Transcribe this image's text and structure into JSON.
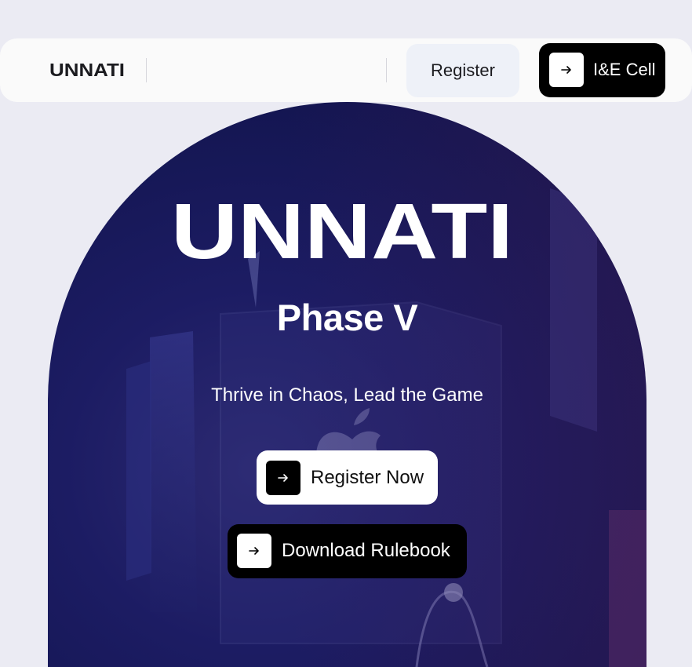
{
  "navbar": {
    "logo_text": "UNNATI",
    "register_label": "Register",
    "ie_cell_label": "I&E Cell"
  },
  "hero": {
    "logo_text": "UNNATI",
    "phase": "Phase V",
    "tagline": "Thrive in Chaos, Lead the Game",
    "register_now_label": "Register Now",
    "rulebook_label": "Download Rulebook"
  },
  "icons": {
    "arrow": "arrow-right-icon",
    "background": "apple-icon"
  },
  "colors": {
    "page_bg": "#ebebf3",
    "nav_bg": "#fafafa",
    "hero_bg": "#1c1c63",
    "accent_dark": "#000000",
    "register_bg": "#eef1f8"
  }
}
